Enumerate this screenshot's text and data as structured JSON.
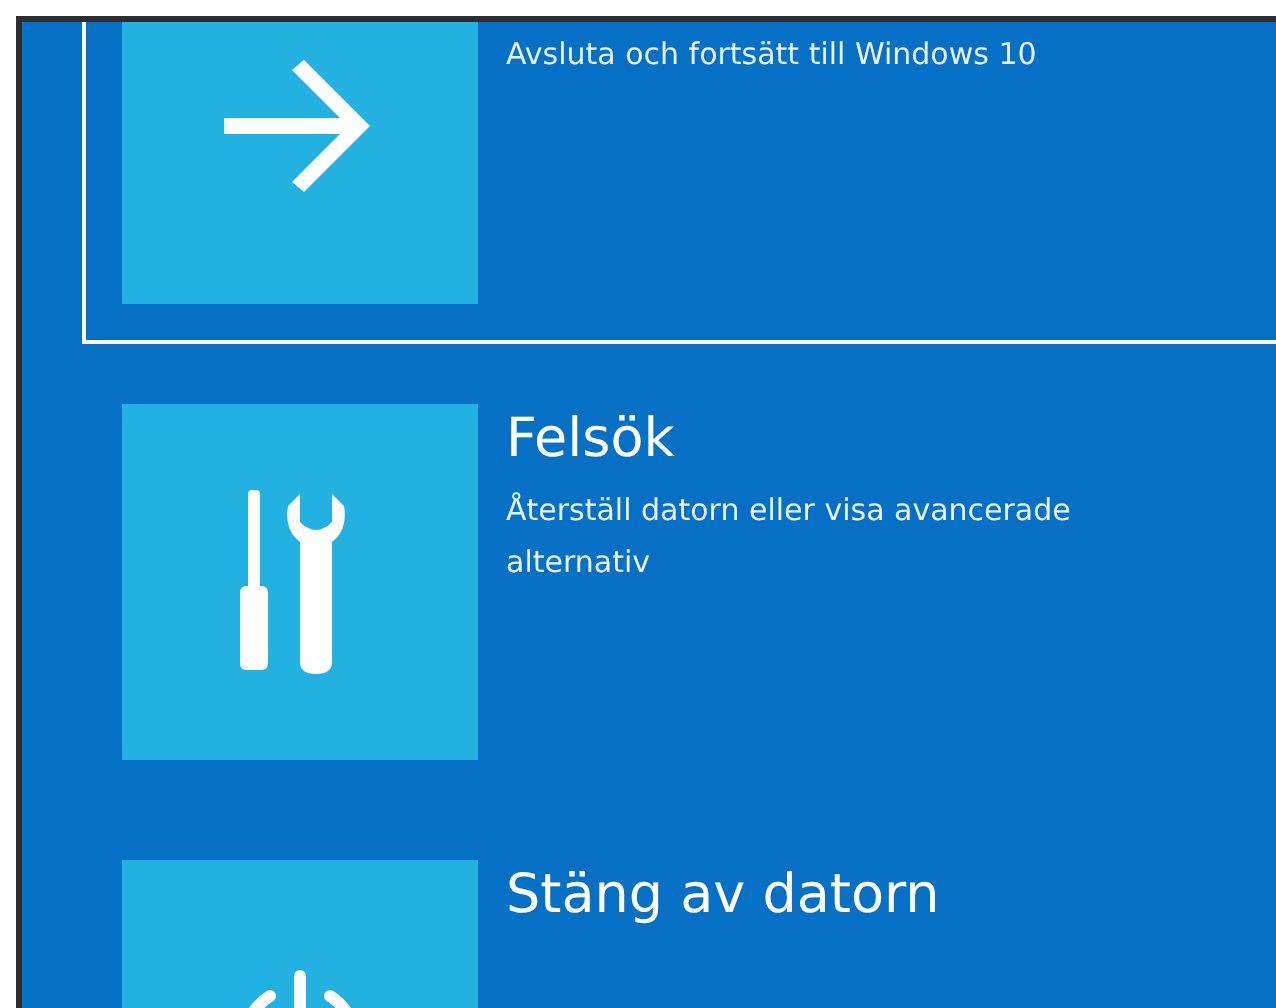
{
  "options": [
    {
      "kind": "arrow",
      "selected": true,
      "description_lines": [
        "Avsluta och fortsätt till Windows 10"
      ]
    },
    {
      "kind": "tools",
      "selected": false,
      "title": "Felsök",
      "description_lines": [
        "Återställ datorn eller visa avancerade",
        "alternativ"
      ]
    },
    {
      "kind": "power",
      "selected": false,
      "title": "Stäng av datorn"
    }
  ]
}
